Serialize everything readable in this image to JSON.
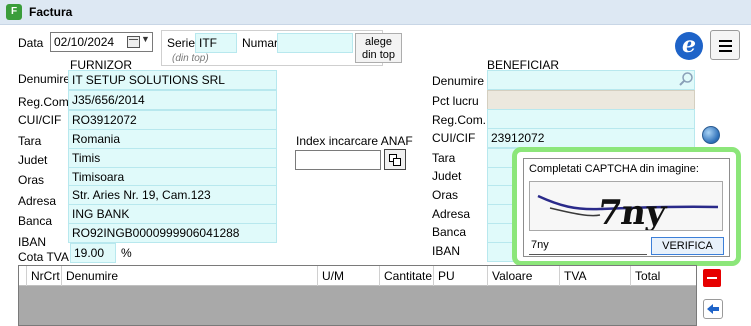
{
  "window": {
    "title": "Factura",
    "app_icon_glyph": "F"
  },
  "header": {
    "data_label": "Data",
    "data_value": "02/10/2024",
    "serie_label": "Serie",
    "serie_value": "ITF",
    "serie_hint": "(din top)",
    "numar_label": "Numar",
    "numar_value": "",
    "alege_line1": "alege",
    "alege_line2": "din top",
    "logo_glyph": "e"
  },
  "furnizor": {
    "title": "FURNIZOR",
    "labels": {
      "denumire": "Denumire",
      "regcom": "Reg.Com.",
      "cui": "CUI/CIF",
      "tara": "Tara",
      "judet": "Judet",
      "oras": "Oras",
      "adresa": "Adresa",
      "banca": "Banca",
      "iban": "IBAN",
      "cota_tva": "Cota TVA"
    },
    "values": {
      "denumire": "IT SETUP SOLUTIONS SRL",
      "regcom": "J35/656/2014",
      "cui": "RO3912072",
      "tara": "Romania",
      "judet": "Timis",
      "oras": "Timisoara",
      "adresa": "Str. Aries Nr. 19, Cam.123",
      "banca": "ING BANK",
      "iban": "RO92INGB0000999906041288",
      "cota_tva": "19.00",
      "cota_unit": "%"
    }
  },
  "anaf": {
    "label": "Index incarcare ANAF",
    "value": ""
  },
  "beneficiar": {
    "title": "BENEFICIAR",
    "labels": {
      "denumire": "Denumire",
      "pct_lucru": "Pct lucru",
      "regcom": "Reg.Com.",
      "cui": "CUI/CIF",
      "tara": "Tara",
      "judet": "Judet",
      "oras": "Oras",
      "adresa": "Adresa",
      "banca": "Banca",
      "iban": "IBAN"
    },
    "values": {
      "denumire": "",
      "pct_lucru": "",
      "regcom": "",
      "cui": "23912072"
    }
  },
  "captcha": {
    "prompt": "Completati CAPTCHA din imagine:",
    "image_text": "7ny",
    "input_value": "7ny",
    "button_label": "VERIFICA",
    "highlight_color": "#8ce67a"
  },
  "grid": {
    "columns": [
      "NrCrt",
      "Denumire",
      "U/M",
      "Cantitate",
      "PU",
      "Valoare",
      "TVA",
      "Total"
    ]
  },
  "icons": {
    "search": "search-icon",
    "globe": "globe-icon",
    "calendar": "calendar-icon",
    "menu": "menu-icon",
    "copy": "copy-icon",
    "delete": "delete-icon",
    "back": "back-arrow-icon"
  }
}
